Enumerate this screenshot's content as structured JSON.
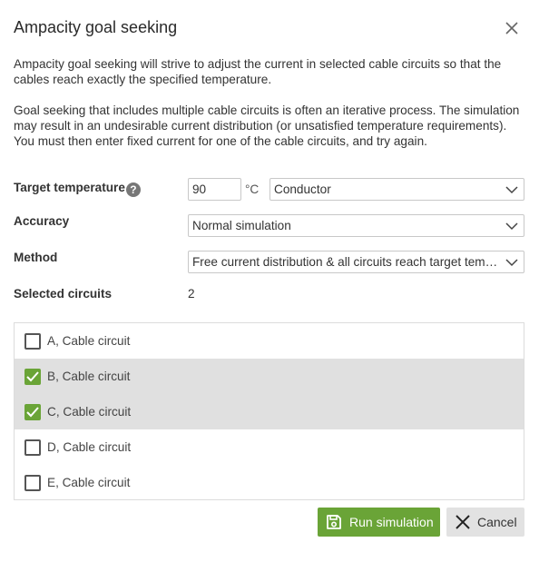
{
  "dialog": {
    "title": "Ampacity goal seeking",
    "intro": "Ampacity goal seeking will strive to adjust the current in selected cable circuits so that the cables reach exactly the specified temperature.",
    "note": "Goal seeking that includes multiple cable circuits is often an iterative process. The simulation may result in an undesirable current distribution (or unsatisfied temperature requirements). You must then enter fixed current for one of the cable circuits, and try again."
  },
  "form": {
    "target_temperature_label": "Target temperature",
    "target_temperature_value": "90",
    "temperature_unit": "°C",
    "temperature_location": "Conductor",
    "accuracy_label": "Accuracy",
    "accuracy_value": "Normal simulation",
    "method_label": "Method",
    "method_value": "Free current distribution & all circuits reach target temperature",
    "selected_circuits_label": "Selected circuits",
    "selected_circuits_count": "2"
  },
  "circuits": [
    {
      "label": "A, Cable circuit",
      "checked": false
    },
    {
      "label": "B, Cable circuit",
      "checked": true
    },
    {
      "label": "C, Cable circuit",
      "checked": true
    },
    {
      "label": "D, Cable circuit",
      "checked": false
    },
    {
      "label": "E, Cable circuit",
      "checked": false
    }
  ],
  "buttons": {
    "run": "Run simulation",
    "cancel": "Cancel"
  },
  "colors": {
    "accent": "#6aa437",
    "selected_row": "#e0e0e0"
  }
}
